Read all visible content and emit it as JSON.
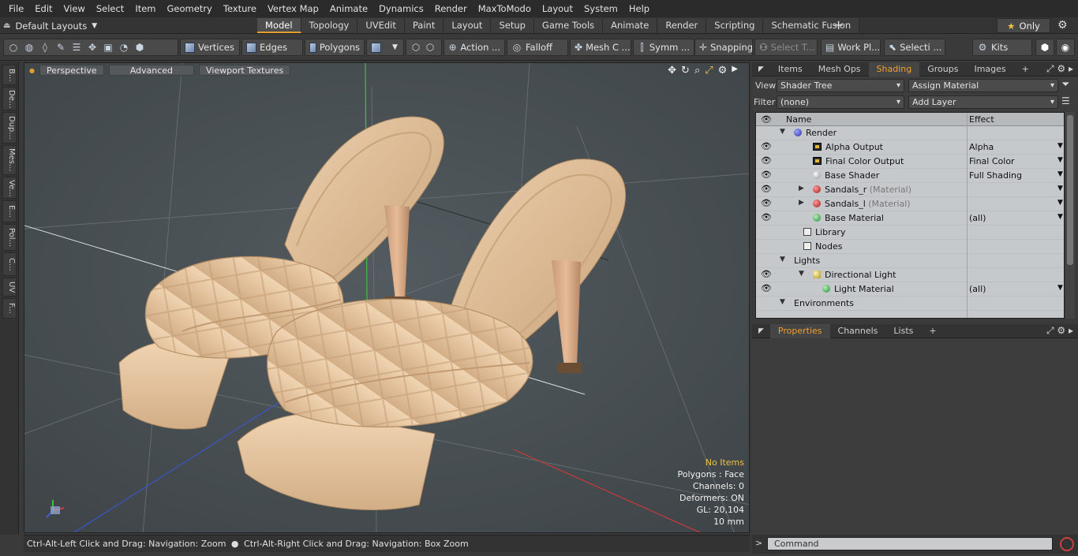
{
  "menubar": [
    "File",
    "Edit",
    "View",
    "Select",
    "Item",
    "Geometry",
    "Texture",
    "Vertex Map",
    "Animate",
    "Dynamics",
    "Render",
    "MaxToModo",
    "Layout",
    "System",
    "Help"
  ],
  "layouts": {
    "label": "Default Layouts"
  },
  "tabs": [
    {
      "label": "Model",
      "active": true
    },
    {
      "label": "Topology"
    },
    {
      "label": "UVEdit"
    },
    {
      "label": "Paint"
    },
    {
      "label": "Layout"
    },
    {
      "label": "Setup"
    },
    {
      "label": "Game Tools"
    },
    {
      "label": "Animate"
    },
    {
      "label": "Render"
    },
    {
      "label": "Scripting"
    },
    {
      "label": "Schematic Fusion"
    }
  ],
  "only_label": "Only",
  "toolbar": {
    "vertices": "Vertices",
    "edges": "Edges",
    "polygons": "Polygons",
    "action": "Action ...",
    "falloff": "Falloff",
    "meshc": "Mesh C ...",
    "symm": "Symm ...",
    "snapping": "Snapping",
    "selectt": "Select T...",
    "workpl": "Work Pl...",
    "selecti": "Selecti ...",
    "kits": "Kits"
  },
  "left_strip": [
    "B...",
    "De...",
    "Dup...",
    "Mes...",
    "Ve...",
    "E...",
    "Pol...",
    "C...",
    "UV",
    "F..."
  ],
  "viewport": {
    "perspective": "Perspective",
    "advanced": "Advanced",
    "textures": "Viewport Textures",
    "info": {
      "items": "No Items",
      "polygons": "Polygons : Face",
      "channels": "Channels: 0",
      "deformers": "Deformers: ON",
      "gl": "GL: 20,104",
      "scale": "10 mm"
    }
  },
  "statusbar": {
    "left": "Ctrl-Alt-Left Click and Drag: Navigation: Zoom",
    "right": "Ctrl-Alt-Right Click and Drag: Navigation: Box Zoom"
  },
  "right_tabs": [
    {
      "label": "Items"
    },
    {
      "label": "Mesh Ops"
    },
    {
      "label": "Shading",
      "active": true
    },
    {
      "label": "Groups"
    },
    {
      "label": "Images"
    }
  ],
  "shading_form": {
    "view_label": "View",
    "view_value": "Shader Tree",
    "assign": "Assign Material",
    "filter_label": "Filter",
    "filter_value": "(none)",
    "add_layer": "Add Layer"
  },
  "tree": {
    "col_name": "Name",
    "col_effect": "Effect",
    "rows": [
      {
        "name": "Render",
        "indent": 0,
        "icon": "render",
        "eye": false,
        "expand": "open"
      },
      {
        "name": "Alpha Output",
        "indent": 2,
        "icon": "output",
        "eye": true,
        "effect": "Alpha"
      },
      {
        "name": "Final Color Output",
        "indent": 2,
        "icon": "output",
        "eye": true,
        "effect": "Final Color"
      },
      {
        "name": "Base Shader",
        "indent": 2,
        "icon": "shader",
        "eye": true,
        "effect": "Full Shading"
      },
      {
        "name": "Sandals_r",
        "sub": "(Material)",
        "indent": 2,
        "icon": "material",
        "eye": true,
        "expand": "closed",
        "effect": ""
      },
      {
        "name": "Sandals_l",
        "sub": "(Material)",
        "indent": 2,
        "icon": "material",
        "eye": true,
        "expand": "closed",
        "effect": ""
      },
      {
        "name": "Base Material",
        "indent": 2,
        "icon": "basemat",
        "eye": true,
        "effect": "(all)"
      },
      {
        "name": "Library",
        "indent": 1,
        "icon": "folder",
        "eye": false
      },
      {
        "name": "Nodes",
        "indent": 1,
        "icon": "folder",
        "eye": false
      },
      {
        "name": "Lights",
        "indent": 0,
        "icon": "none",
        "eye": false,
        "expand": "open"
      },
      {
        "name": "Directional Light",
        "indent": 2,
        "icon": "light",
        "eye": true,
        "expand": "open"
      },
      {
        "name": "Light Material",
        "indent": 3,
        "icon": "basemat",
        "eye": true,
        "effect": "(all)"
      },
      {
        "name": "Environments",
        "indent": 0,
        "icon": "none",
        "eye": false,
        "expand": "open"
      }
    ]
  },
  "prop_tabs": [
    {
      "label": "Properties",
      "active": true
    },
    {
      "label": "Channels"
    },
    {
      "label": "Lists"
    }
  ],
  "command": {
    "placeholder": "Command"
  },
  "colors": {
    "accent": "#f0a030",
    "viewport_bg": "#4a5054",
    "shoe": "#e3c29e"
  }
}
